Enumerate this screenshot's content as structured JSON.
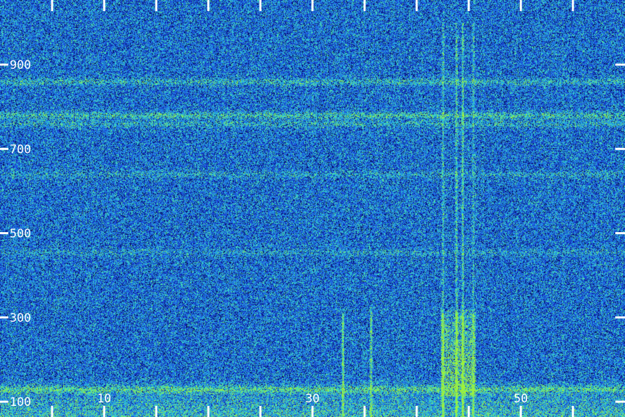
{
  "chart_data": {
    "type": "heatmap",
    "title": "",
    "xlabel": "",
    "ylabel": "",
    "xlim": [
      0,
      60
    ],
    "ylim": [
      100,
      1000
    ],
    "x_ticks": [
      0,
      5,
      10,
      15,
      20,
      25,
      30,
      35,
      40,
      45,
      50,
      55
    ],
    "x_tick_labels": [
      "10",
      "30",
      "50"
    ],
    "x_tick_label_values": [
      10,
      30,
      50
    ],
    "y_ticks": [
      100,
      300,
      500,
      700,
      900
    ],
    "y_tick_labels": [
      "100",
      "300",
      "500",
      "700",
      "900"
    ],
    "grid": false,
    "colormap": [
      "#000010",
      "#0a1a9a",
      "#1e4fe0",
      "#22a6e6",
      "#3de0c0",
      "#9ef03a"
    ],
    "background_noise_level": 0.35,
    "horizontal_bands": [
      {
        "y": 860,
        "intensity": 0.55
      },
      {
        "y": 780,
        "intensity": 0.7
      },
      {
        "y": 760,
        "intensity": 0.45
      },
      {
        "y": 640,
        "intensity": 0.35
      },
      {
        "y": 455,
        "intensity": 0.3
      },
      {
        "y": 130,
        "intensity": 0.8
      }
    ],
    "vertical_lines": [
      {
        "x": 32.9,
        "y_top": 310,
        "intensity": 0.8
      },
      {
        "x": 35.6,
        "y_top": 330,
        "intensity": 0.6
      },
      {
        "x": 42.5,
        "y_top": 1000,
        "intensity": 0.9
      },
      {
        "x": 43.8,
        "y_top": 1000,
        "intensity": 1.0
      },
      {
        "x": 44.4,
        "y_top": 1000,
        "intensity": 1.0
      },
      {
        "x": 45.4,
        "y_top": 1000,
        "intensity": 0.7
      }
    ],
    "burst_region": {
      "x_start": 42.3,
      "x_end": 45.6,
      "y_top": 320,
      "intensity": 1.0
    }
  }
}
